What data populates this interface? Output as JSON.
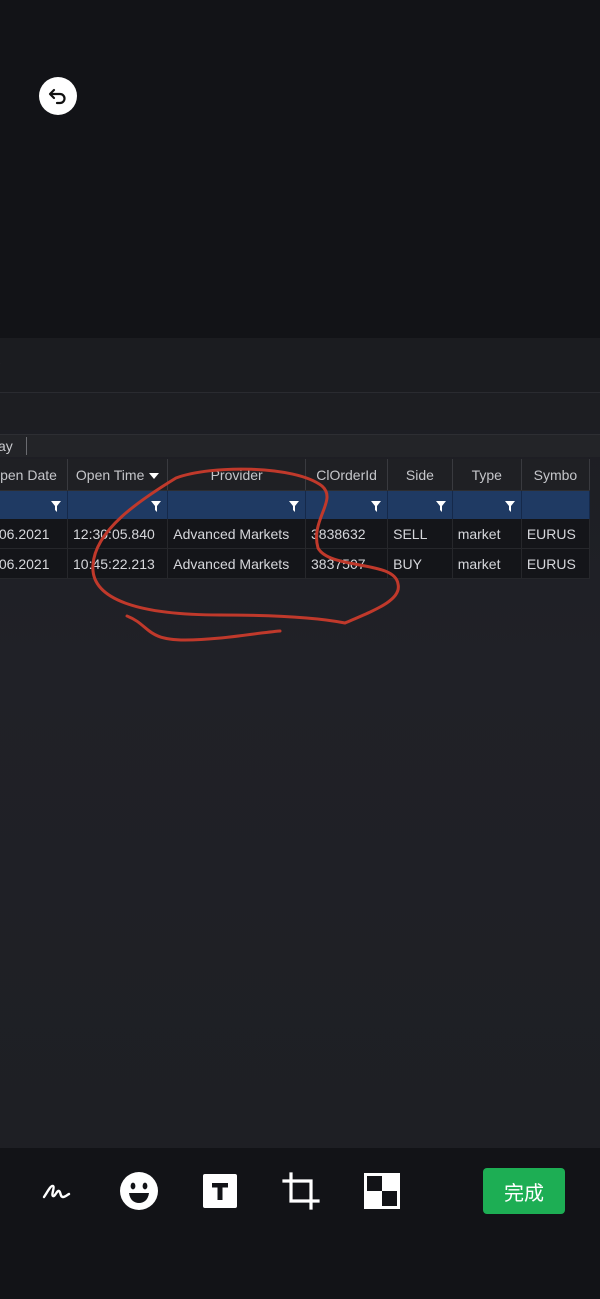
{
  "editor": {
    "undo_icon": "undo-icon",
    "done_label": "完成",
    "tools": [
      "pen-icon",
      "emoji-icon",
      "text-icon",
      "crop-icon",
      "mosaic-icon"
    ],
    "colors": {
      "background": "#121317",
      "done": "#1dae54",
      "annotation": "#c0392b",
      "filter_row": "#1f3a63"
    }
  },
  "screenshot": {
    "toolbar_label": "ay",
    "columns": [
      "pen Date",
      "Open Time",
      "Provider",
      "ClOrderId",
      "Side",
      "Type",
      "Symbo"
    ],
    "sorted_column": "Open Time",
    "rows": [
      [
        ".06.2021",
        "12:30:05.840",
        "Advanced Markets",
        "3838632",
        "SELL",
        "market",
        "EURUS"
      ],
      [
        ".06.2021",
        "10:45:22.213",
        "Advanced Markets",
        "3837507",
        "BUY",
        "market",
        "EURUS"
      ]
    ]
  }
}
